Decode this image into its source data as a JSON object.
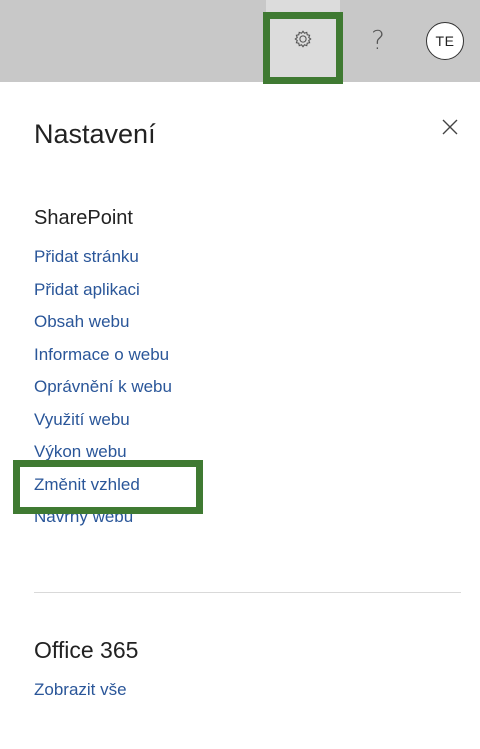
{
  "topbar": {
    "settings_icon": "gear-icon",
    "help_label": "?",
    "avatar_initials": "TE"
  },
  "panel": {
    "title": "Nastavení",
    "close_icon": "close-icon"
  },
  "sharepoint": {
    "heading": "SharePoint",
    "links": [
      "Přidat stránku",
      "Přidat aplikaci",
      "Obsah webu",
      "Informace o webu",
      "Oprávnění k webu",
      "Využití webu",
      "Výkon webu",
      "Změnit vzhled",
      "Návrhy webu"
    ]
  },
  "office365": {
    "heading": "Office 365",
    "link": "Zobrazit vše"
  },
  "colors": {
    "highlight": "#3f7a32",
    "link": "#2a5699",
    "topbar": "#c8c8c8"
  }
}
